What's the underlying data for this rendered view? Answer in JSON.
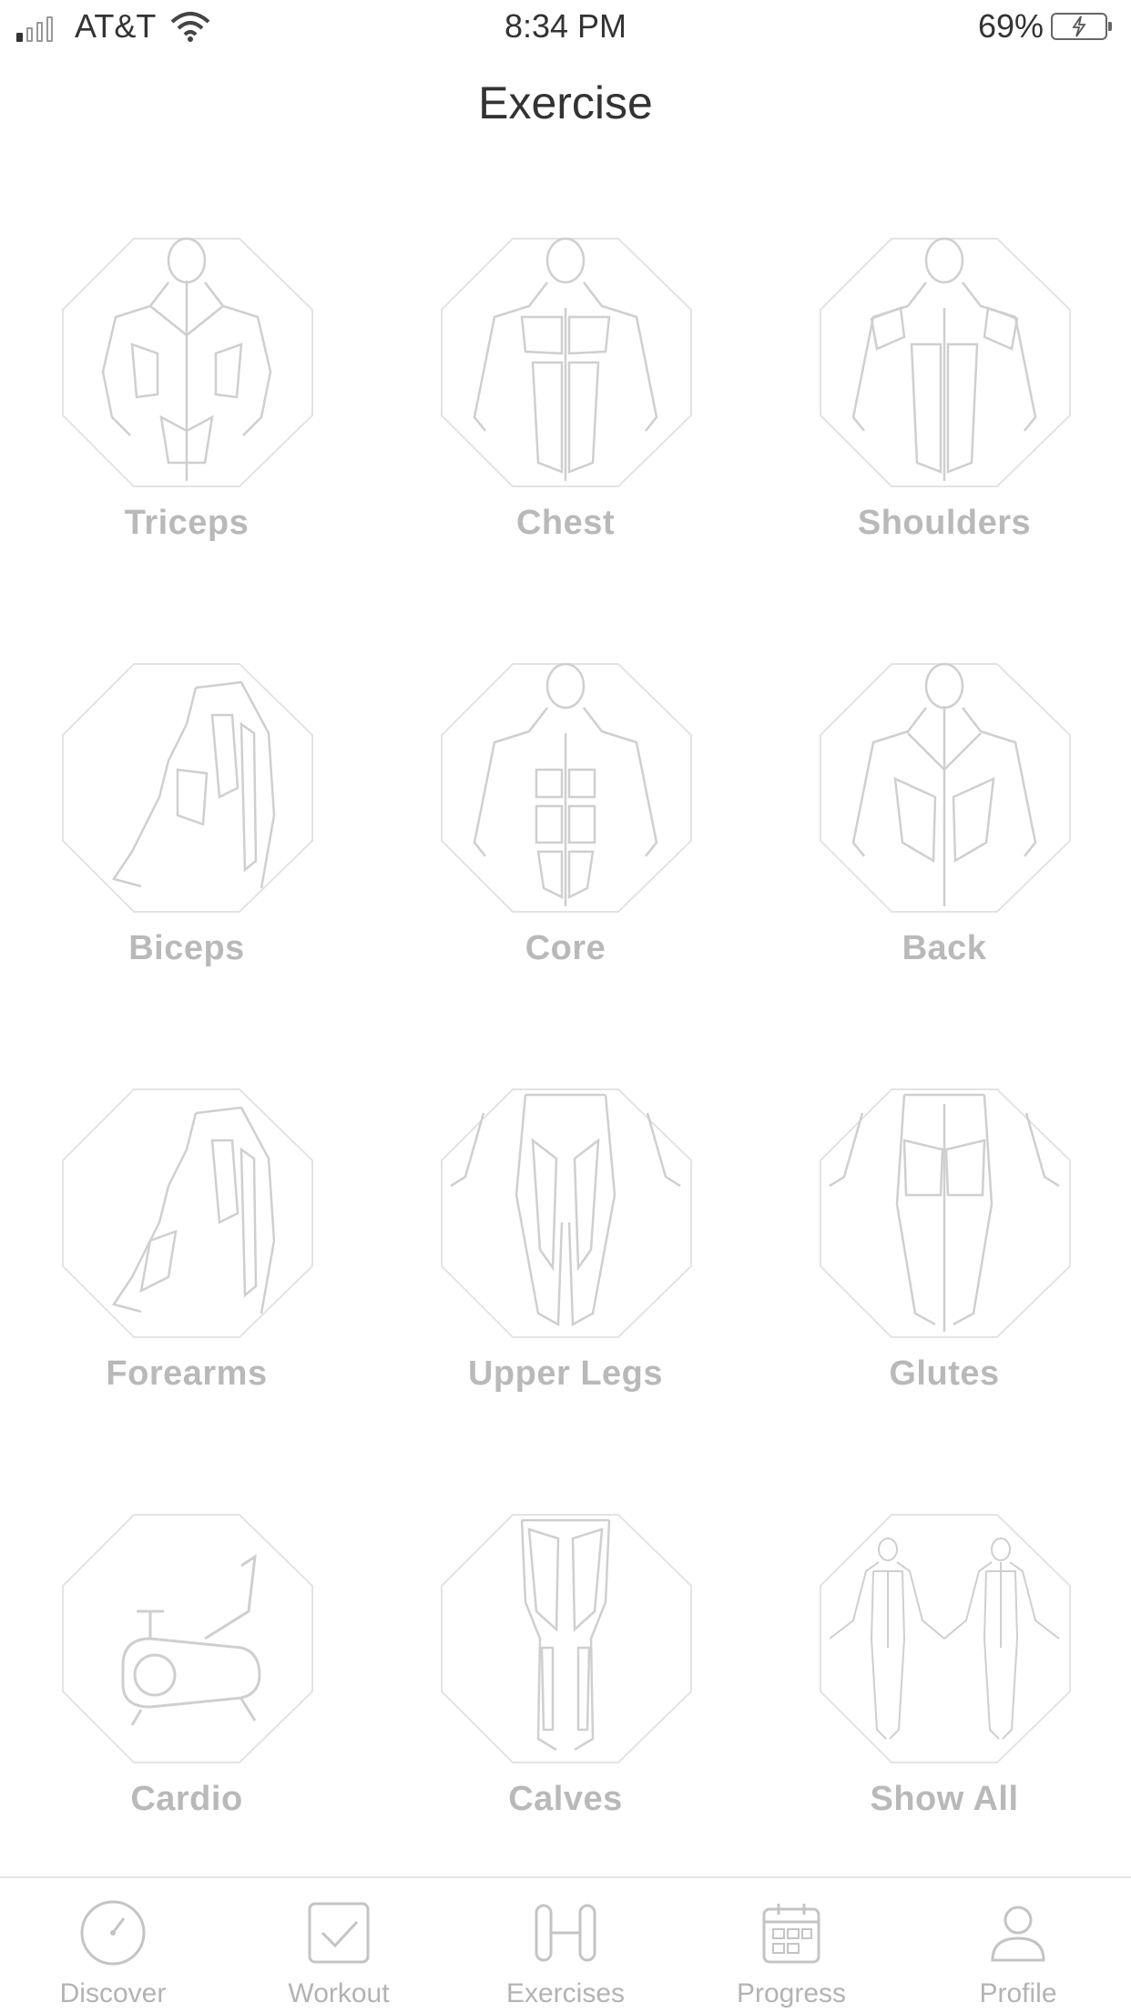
{
  "status_bar": {
    "carrier": "AT&T",
    "time": "8:34 PM",
    "battery_percent": "69%",
    "signal_bars": 1,
    "charging": true
  },
  "header": {
    "title": "Exercise"
  },
  "categories": [
    {
      "label": "Triceps",
      "icon": "upper-body-back-icon"
    },
    {
      "label": "Chest",
      "icon": "upper-body-front-icon"
    },
    {
      "label": "Shoulders",
      "icon": "shoulders-front-icon"
    },
    {
      "label": "Biceps",
      "icon": "arm-side-icon"
    },
    {
      "label": "Core",
      "icon": "torso-front-icon"
    },
    {
      "label": "Back",
      "icon": "torso-back-icon"
    },
    {
      "label": "Forearms",
      "icon": "forearm-side-icon"
    },
    {
      "label": "Upper Legs",
      "icon": "upper-legs-icon"
    },
    {
      "label": "Glutes",
      "icon": "glutes-icon"
    },
    {
      "label": "Cardio",
      "icon": "exercise-bike-icon"
    },
    {
      "label": "Calves",
      "icon": "calves-icon"
    },
    {
      "label": "Show All",
      "icon": "full-body-icon"
    }
  ],
  "tab_bar": {
    "items": [
      {
        "label": "Discover",
        "icon": "compass-icon"
      },
      {
        "label": "Workout",
        "icon": "checkbox-icon"
      },
      {
        "label": "Exercises",
        "icon": "dumbbell-icon"
      },
      {
        "label": "Progress",
        "icon": "calendar-icon"
      },
      {
        "label": "Profile",
        "icon": "person-icon"
      }
    ],
    "active_index": 2
  },
  "colors": {
    "label_gray": "#b9b9b9",
    "outline_gray": "#d6d6d6",
    "tab_gray": "#b3b3b3"
  }
}
